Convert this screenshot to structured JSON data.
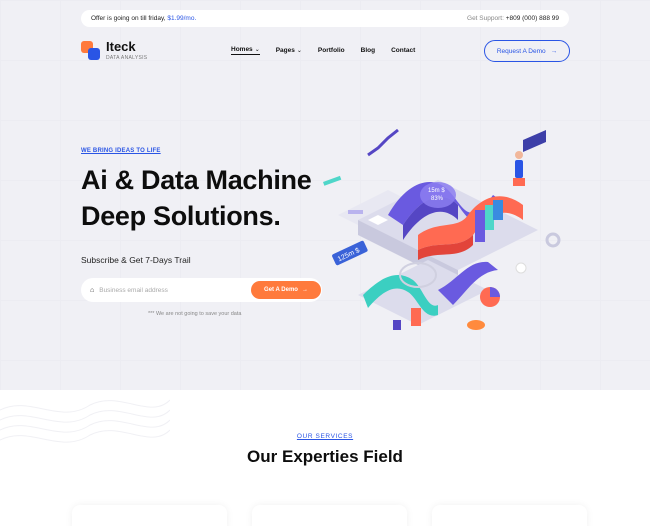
{
  "topbar": {
    "offer_text": "Offer is going on till friday,",
    "offer_price": "$1.99/mo.",
    "support_label": "Get Support:",
    "support_phone": "+809 (000) 888 99"
  },
  "brand": {
    "name": "Iteck",
    "tagline": "DATA ANALYSIS",
    "colors": {
      "orange": "#ff7a3c",
      "blue": "#2a55e5"
    }
  },
  "nav": {
    "items": [
      {
        "label": "Homes",
        "has_dropdown": true,
        "active": true
      },
      {
        "label": "Pages",
        "has_dropdown": true,
        "active": false
      },
      {
        "label": "Portfolio",
        "has_dropdown": false,
        "active": false
      },
      {
        "label": "Blog",
        "has_dropdown": false,
        "active": false
      },
      {
        "label": "Contact",
        "has_dropdown": false,
        "active": false
      }
    ],
    "cta_label": "Request A Demo",
    "cta_icon": "arrow-right-icon"
  },
  "hero": {
    "eyebrow": "WE BRING IDEAS TO LIFE",
    "title_line1": "Ai & Data Machine",
    "title_line2": "Deep Solutions.",
    "subscribe": "Subscribe & Get 7-Days Trail",
    "email_placeholder": "Business email address",
    "email_icon": "home-icon",
    "button_label": "Get A Demo",
    "note": "*** We are not going to save your data",
    "illustration": {
      "label_a": "15m $",
      "label_b": "83%",
      "label_c": "125m $"
    }
  },
  "services": {
    "eyebrow": "OUR SERVICES",
    "title": "Our Experties Field"
  }
}
